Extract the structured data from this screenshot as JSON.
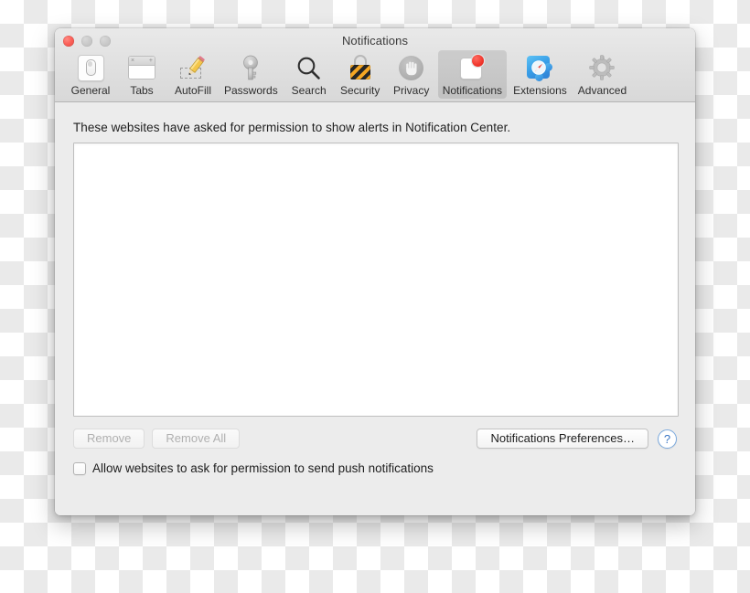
{
  "window": {
    "title": "Notifications",
    "traffic_lights": [
      {
        "name": "close",
        "state": "active"
      },
      {
        "name": "minimize",
        "state": "disabled"
      },
      {
        "name": "zoom",
        "state": "disabled"
      }
    ]
  },
  "toolbar": {
    "items": [
      {
        "label": "General",
        "icon": "general-switch-icon",
        "selected": false
      },
      {
        "label": "Tabs",
        "icon": "browser-tabs-icon",
        "selected": false
      },
      {
        "label": "AutoFill",
        "icon": "pencil-autofill-icon",
        "selected": false
      },
      {
        "label": "Passwords",
        "icon": "key-icon",
        "selected": false
      },
      {
        "label": "Search",
        "icon": "magnifying-glass-icon",
        "selected": false
      },
      {
        "label": "Security",
        "icon": "striped-padlock-icon",
        "selected": false
      },
      {
        "label": "Privacy",
        "icon": "hand-stop-icon",
        "selected": false
      },
      {
        "label": "Notifications",
        "icon": "notification-badge-icon",
        "selected": true
      },
      {
        "label": "Extensions",
        "icon": "safari-puzzle-icon",
        "selected": false
      },
      {
        "label": "Advanced",
        "icon": "gear-icon",
        "selected": false
      }
    ]
  },
  "main": {
    "intro_text": "These websites have asked for permission to show alerts in Notification Center.",
    "website_list": [],
    "buttons": {
      "remove": {
        "label": "Remove",
        "enabled": false
      },
      "remove_all": {
        "label": "Remove All",
        "enabled": false
      },
      "notifications_preferences": {
        "label": "Notifications Preferences…",
        "enabled": true
      },
      "help": {
        "label": "?",
        "enabled": true
      }
    },
    "checkbox": {
      "label": "Allow websites to ask for permission to send push notifications",
      "checked": false
    }
  },
  "colors": {
    "accent_blue": "#3a76c4",
    "badge_red": "#f0362c",
    "window_bg": "#ececec",
    "toolbar_top": "#e9e9e9",
    "toolbar_bottom": "#d8d8d8"
  }
}
